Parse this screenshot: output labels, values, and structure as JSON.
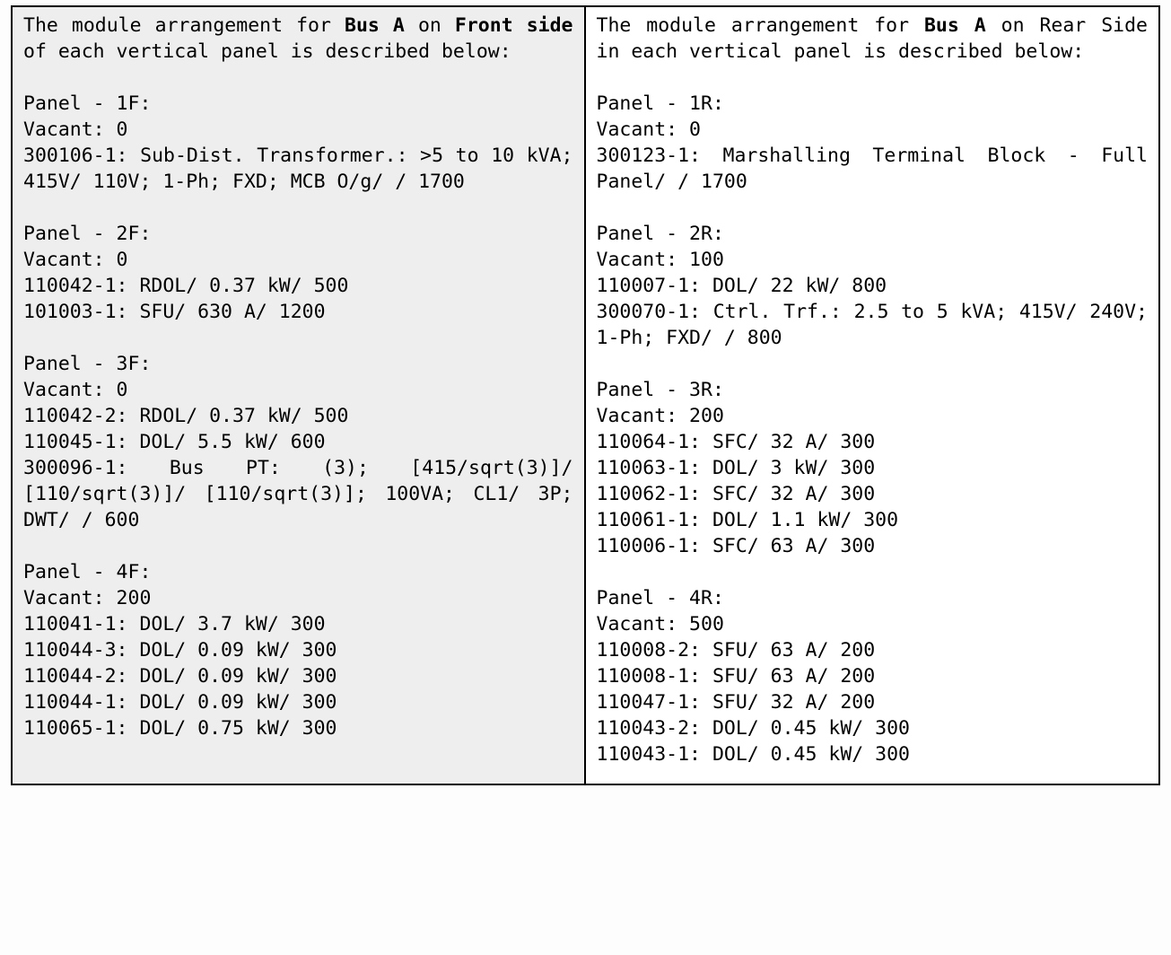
{
  "front": {
    "intro_parts": {
      "t1": "The module arrangement for ",
      "bus": "Bus A",
      "t2": " on ",
      "side": "Front side",
      "t3": " of each vertical panel is described below:"
    },
    "panels": [
      {
        "title": "Panel - 1F:",
        "vacant": "Vacant: 0",
        "modules": [
          "300106-1: Sub-Dist. Transformer.: >5 to 10 kVA; 415V/ 110V; 1-Ph; FXD; MCB O/g/  / 1700"
        ]
      },
      {
        "title": "Panel - 2F:",
        "vacant": "Vacant: 0",
        "modules": [
          "110042-1: RDOL/ 0.37 kW/ 500",
          "101003-1: SFU/ 630 A/ 1200"
        ]
      },
      {
        "title": "Panel - 3F:",
        "vacant": "Vacant: 0",
        "modules": [
          "110042-2: RDOL/ 0.37 kW/ 500",
          "110045-1: DOL/ 5.5 kW/ 600",
          "300096-1: Bus PT: (3); [415/sqrt(3)]/ [110/sqrt(3)]/ [110/sqrt(3)]; 100VA; CL1/ 3P; DWT/  / 600"
        ]
      },
      {
        "title": "Panel - 4F:",
        "vacant": "Vacant: 200",
        "modules": [
          "110041-1: DOL/ 3.7 kW/ 300",
          "110044-3: DOL/ 0.09 kW/ 300",
          "110044-2: DOL/ 0.09 kW/ 300",
          "110044-1: DOL/ 0.09 kW/ 300",
          "110065-1: DOL/ 0.75 kW/ 300"
        ]
      }
    ]
  },
  "rear": {
    "intro_parts": {
      "t1": "The module arrangement for ",
      "bus": "Bus A",
      "t2": " on Rear Side in each vertical panel is described below:"
    },
    "panels": [
      {
        "title": "Panel - 1R:",
        "vacant": "Vacant: 0",
        "modules": [
          "300123-1: Marshalling Terminal Block - Full Panel/  / 1700"
        ]
      },
      {
        "title": "Panel - 2R:",
        "vacant": "Vacant: 100",
        "modules": [
          "110007-1: DOL/ 22 kW/ 800",
          "300070-1: Ctrl. Trf.: 2.5 to 5 kVA; 415V/ 240V; 1-Ph; FXD/  / 800"
        ]
      },
      {
        "title": "Panel - 3R:",
        "vacant": "Vacant: 200",
        "modules": [
          "110064-1: SFC/ 32 A/ 300",
          "110063-1: DOL/ 3 kW/ 300",
          "110062-1: SFC/ 32 A/ 300",
          "110061-1: DOL/ 1.1 kW/ 300",
          "110006-1: SFC/ 63 A/ 300"
        ]
      },
      {
        "title": "Panel - 4R:",
        "vacant": "Vacant: 500",
        "modules": [
          "110008-2: SFU/ 63 A/ 200",
          "110008-1: SFU/ 63 A/ 200",
          "110047-1: SFU/ 32 A/ 200",
          "110043-2: DOL/ 0.45 kW/ 300",
          "110043-1: DOL/ 0.45 kW/ 300"
        ]
      }
    ]
  }
}
